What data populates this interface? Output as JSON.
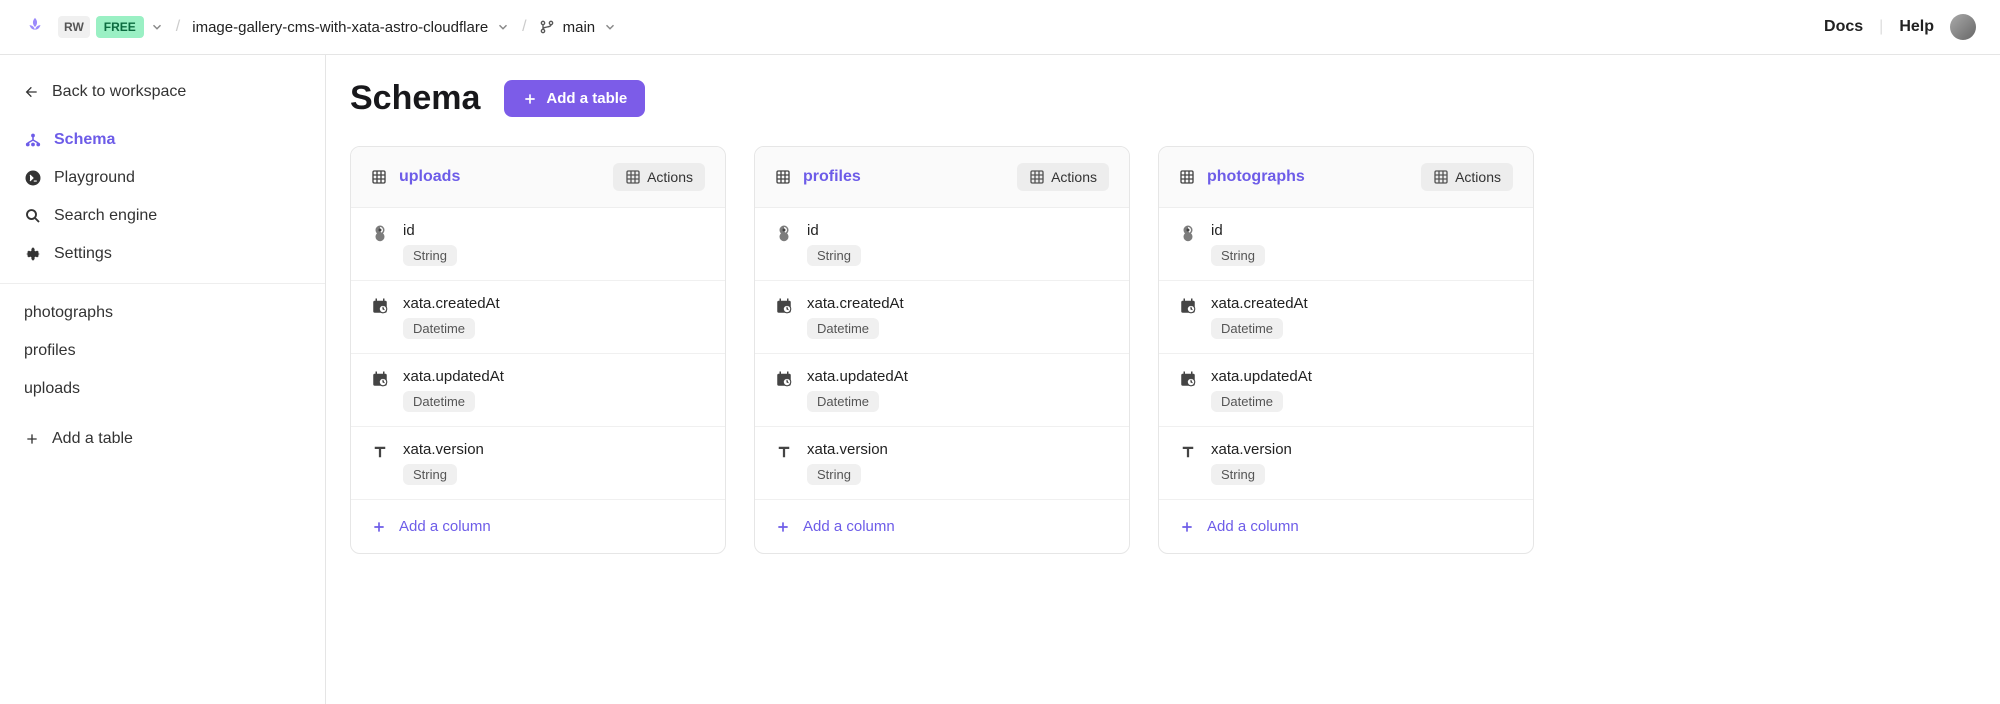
{
  "topbar": {
    "workspace_initials": "RW",
    "plan_badge": "FREE",
    "project": "image-gallery-cms-with-xata-astro-cloudflare",
    "branch": "main",
    "docs": "Docs",
    "help": "Help"
  },
  "sidebar": {
    "back": "Back to workspace",
    "nav": [
      {
        "label": "Schema",
        "icon": "schema",
        "active": true
      },
      {
        "label": "Playground",
        "icon": "playground",
        "active": false
      },
      {
        "label": "Search engine",
        "icon": "search",
        "active": false
      },
      {
        "label": "Settings",
        "icon": "settings",
        "active": false
      }
    ],
    "tables": [
      "photographs",
      "profiles",
      "uploads"
    ],
    "add_table": "Add a table"
  },
  "main": {
    "title": "Schema",
    "add_table_btn": "Add a table",
    "actions_label": "Actions",
    "add_column_label": "Add a column",
    "tables": [
      {
        "name": "uploads",
        "columns": [
          {
            "name": "id",
            "type": "String",
            "icon": "id"
          },
          {
            "name": "xata.createdAt",
            "type": "Datetime",
            "icon": "datetime"
          },
          {
            "name": "xata.updatedAt",
            "type": "Datetime",
            "icon": "datetime"
          },
          {
            "name": "xata.version",
            "type": "String",
            "icon": "text"
          }
        ]
      },
      {
        "name": "profiles",
        "columns": [
          {
            "name": "id",
            "type": "String",
            "icon": "id"
          },
          {
            "name": "xata.createdAt",
            "type": "Datetime",
            "icon": "datetime"
          },
          {
            "name": "xata.updatedAt",
            "type": "Datetime",
            "icon": "datetime"
          },
          {
            "name": "xata.version",
            "type": "String",
            "icon": "text"
          }
        ]
      },
      {
        "name": "photographs",
        "columns": [
          {
            "name": "id",
            "type": "String",
            "icon": "id"
          },
          {
            "name": "xata.createdAt",
            "type": "Datetime",
            "icon": "datetime"
          },
          {
            "name": "xata.updatedAt",
            "type": "Datetime",
            "icon": "datetime"
          },
          {
            "name": "xata.version",
            "type": "String",
            "icon": "text"
          }
        ]
      }
    ]
  }
}
